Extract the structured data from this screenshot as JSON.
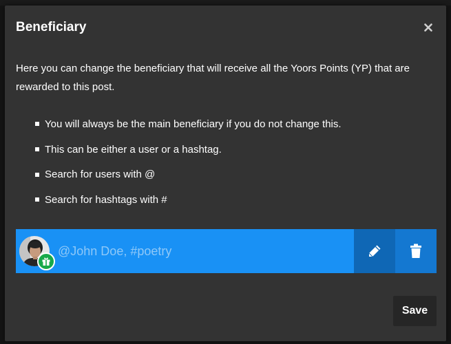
{
  "modal": {
    "title": "Beneficiary",
    "intro": "Here you can change the beneficiary that will receive all the Yoors Points (YP) that are rewarded to this post.",
    "bullets": [
      "You will always be the main beneficiary if you do not change this.",
      "This can be either a user or a hashtag.",
      "Search for users with @",
      "Search for hashtags with #"
    ],
    "beneficiary": {
      "value": "",
      "placeholder": "@John Doe, #poetry"
    },
    "save_label": "Save"
  },
  "icons": {
    "close": "close-icon",
    "gift": "gift-icon",
    "edit": "pencil-icon",
    "delete": "trash-icon"
  },
  "colors": {
    "modal_bg": "#333333",
    "accent": "#1991f5",
    "edit_button": "#0f67b5",
    "delete_button": "#1478d1",
    "gift_badge": "#17a94a",
    "save_button": "#262626"
  }
}
